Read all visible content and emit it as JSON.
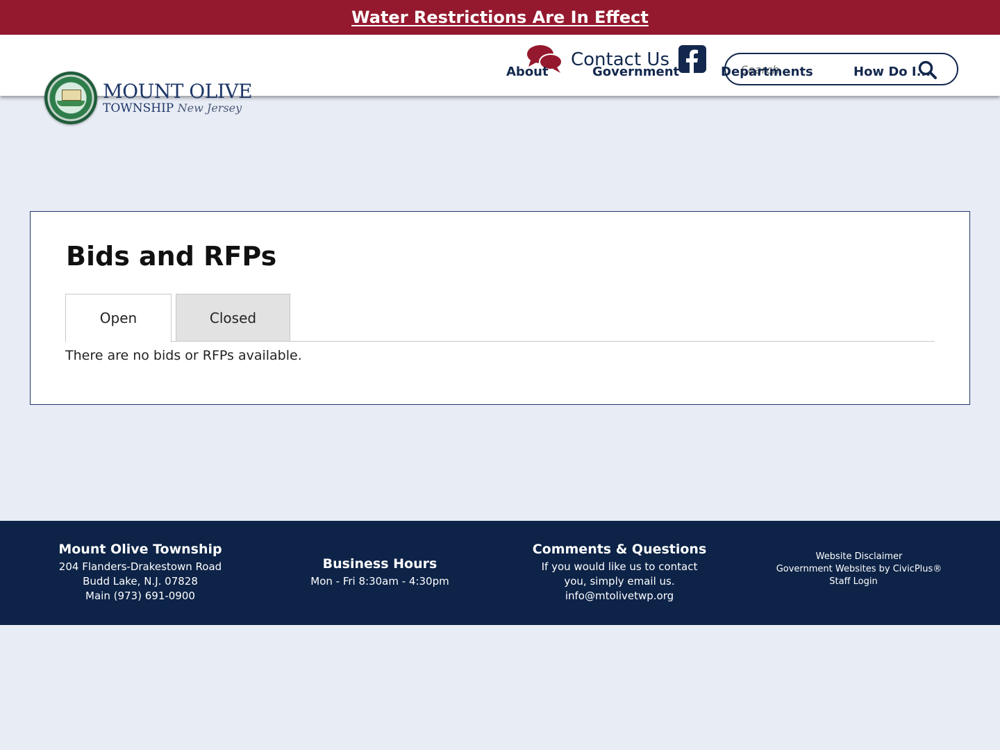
{
  "alert": {
    "text": "Water Restrictions Are In Effect"
  },
  "logo": {
    "line1": "MOUNT OLIVE",
    "line2": "TOWNSHIP",
    "line2_script": "New Jersey"
  },
  "header": {
    "contact_label": "Contact Us",
    "search_placeholder": "Search...",
    "nav": [
      "About",
      "Government",
      "Departments",
      "How Do I..."
    ]
  },
  "main": {
    "title": "Bids and RFPs",
    "tabs": [
      {
        "label": "Open",
        "selected": true
      },
      {
        "label": "Closed",
        "selected": false
      }
    ],
    "empty_message": "There are no bids or RFPs available."
  },
  "footer": {
    "address": {
      "title": "Mount Olive Township",
      "lines": [
        "204 Flanders-Drakestown Road",
        "Budd Lake, N.J. 07828",
        "Main (973) 691-0900"
      ]
    },
    "hours": {
      "title": "Business Hours",
      "line": "Mon - Fri 8:30am - 4:30pm"
    },
    "comments": {
      "title": "Comments & Questions",
      "lines": [
        "If you would like us to contact",
        "you, simply email us."
      ],
      "email": "info@mtolivetwp.org"
    },
    "links": [
      "Website Disclaimer",
      "Government Websites by CivicPlus®",
      "Staff Login"
    ]
  },
  "colors": {
    "alert_bg": "#95192e",
    "navy": "#13284d",
    "footer_bg": "#0d2347",
    "page_bg": "#e8ecf4"
  },
  "icons": [
    "chat-bubbles-icon",
    "facebook-icon",
    "search-icon"
  ]
}
